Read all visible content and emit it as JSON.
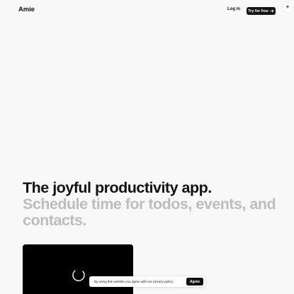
{
  "header": {
    "logo": "Amie",
    "login_label": "Log in",
    "cta_label": "Try for free",
    "cta_icon": "arrow-right-icon",
    "corner_button_icon": "plus-icon",
    "corner_button_glyph": "+"
  },
  "hero": {
    "title": "The joyful productivity app.",
    "subtitle": "Schedule time for todos, events, and contacts."
  },
  "video": {
    "state_icon": "loading-spinner-icon"
  },
  "cookie_banner": {
    "text": "By using this website you agree with our privacy policy.",
    "agree_label": "Agree"
  },
  "colors": {
    "background": "#f8f8f9",
    "text_primary": "#111111",
    "text_muted": "#bdbdbd",
    "button_dark": "#141414"
  }
}
